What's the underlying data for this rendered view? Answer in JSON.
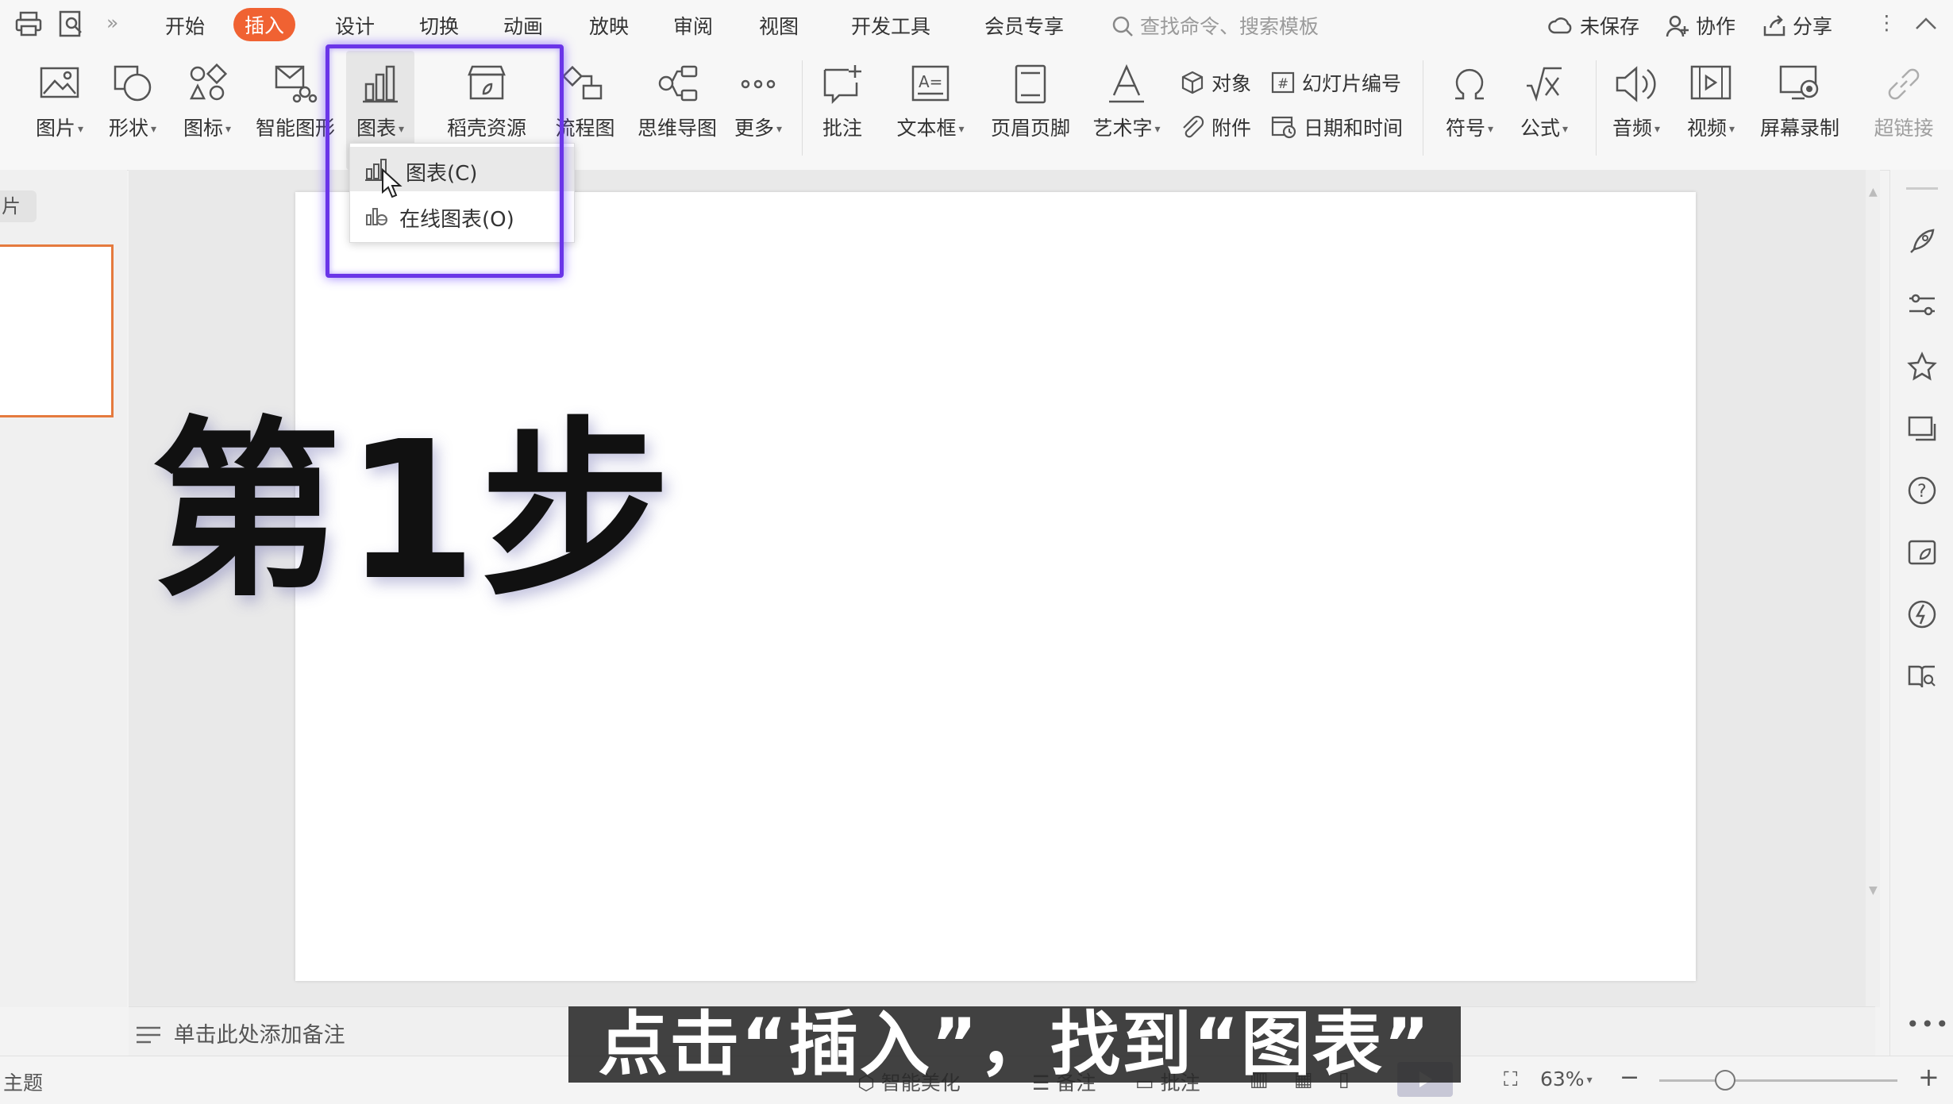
{
  "menu": {
    "items": [
      "开始",
      "插入",
      "设计",
      "切换",
      "动画",
      "放映",
      "审阅",
      "视图",
      "开发工具",
      "会员专享"
    ],
    "active": "插入",
    "search_placeholder": "查找命令、搜索模板",
    "unsaved": "未保存",
    "collab": "协作",
    "share": "分享"
  },
  "ribbon": {
    "picture": "图片",
    "shape": "形状",
    "icon": "图标",
    "smartart": "智能图形",
    "chart": "图表",
    "daoke": "稻壳资源",
    "flowchart": "流程图",
    "mindmap": "思维导图",
    "more": "更多",
    "comment": "批注",
    "textbox": "文本框",
    "header_footer": "页眉页脚",
    "wordart": "艺术字",
    "object": "对象",
    "slide_number": "幻灯片编号",
    "attachment": "附件",
    "datetime": "日期和时间",
    "symbol": "符号",
    "formula": "公式",
    "audio": "音频",
    "video": "视频",
    "screen_record": "屏幕录制",
    "hyperlink": "超链接"
  },
  "dropdown": {
    "item1": "图表(C)",
    "item2": "在线图表(O)"
  },
  "thumb_tab": "片",
  "slide": {
    "big_text": "第1步"
  },
  "notes": {
    "placeholder": "单击此处添加备注"
  },
  "status": {
    "theme": "主题",
    "beautify": "智能美化",
    "notes": "备注",
    "comment": "批注",
    "zoom": "63%"
  },
  "subtitle": "点击“插入”，找到“图表”",
  "colors": {
    "accent": "#f06232",
    "highlight": "#6a35e8",
    "thumb_border": "#e57a3e"
  }
}
